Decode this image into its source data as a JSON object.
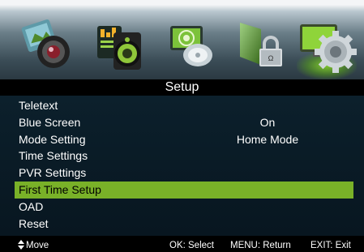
{
  "header": {
    "icons": [
      "picture-icon",
      "sound-icon",
      "channel-icon",
      "lock-icon",
      "setup-gear-icon"
    ],
    "active_index": 4
  },
  "title": "Setup",
  "menu": {
    "items": [
      {
        "label": "Teletext",
        "value": ""
      },
      {
        "label": "Blue Screen",
        "value": "On"
      },
      {
        "label": "Mode Setting",
        "value": "Home Mode"
      },
      {
        "label": "Time Settings",
        "value": ""
      },
      {
        "label": "PVR Settings",
        "value": ""
      },
      {
        "label": "First Time Setup",
        "value": "",
        "selected": true
      },
      {
        "label": "OAD",
        "value": ""
      },
      {
        "label": "Reset",
        "value": ""
      }
    ]
  },
  "footer": {
    "move": "Move",
    "select": "OK: Select",
    "return": "MENU: Return",
    "exit": "EXIT: Exit"
  },
  "colors": {
    "selected_bg": "#79b128",
    "menu_bg": "#0b1e29",
    "active_glow": "#8cdc28"
  }
}
